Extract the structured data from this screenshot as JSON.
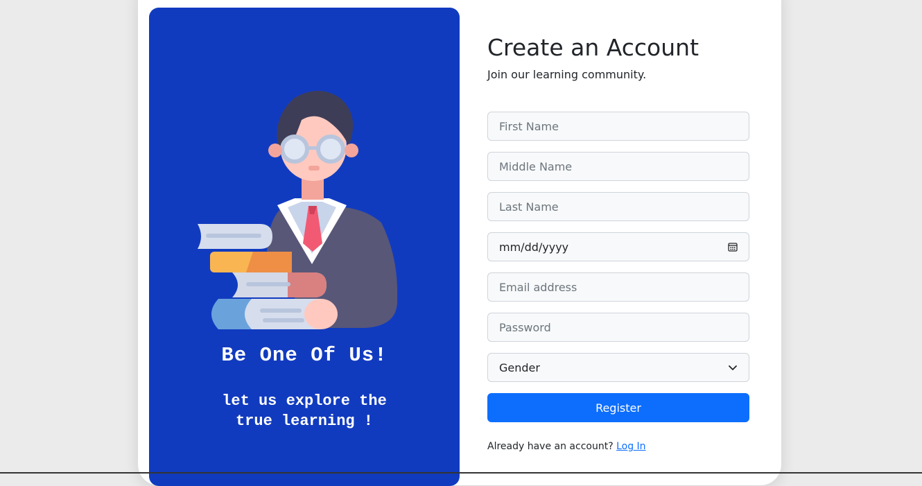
{
  "left_panel": {
    "title": "Be One Of Us!",
    "subtitle": "let us explore the true learning !",
    "illustration": "student-with-books-illustration",
    "background_color": "#113bbf"
  },
  "form": {
    "heading": "Create an Account",
    "subheading": "Join our learning community.",
    "first_name": {
      "placeholder": "First Name",
      "value": ""
    },
    "middle_name": {
      "placeholder": "Middle Name",
      "value": ""
    },
    "last_name": {
      "placeholder": "Last Name",
      "value": ""
    },
    "date_of_birth": {
      "display": "mm/dd/yyyy",
      "icon": "calendar-icon"
    },
    "email": {
      "placeholder": "Email address",
      "value": ""
    },
    "password": {
      "placeholder": "Password",
      "value": ""
    },
    "gender": {
      "selected": "Gender",
      "icon": "chevron-down-icon"
    },
    "register_label": "Register",
    "login_prompt": "Already have an account?",
    "login_link": "Log In",
    "accent_color": "#0d6efd"
  }
}
